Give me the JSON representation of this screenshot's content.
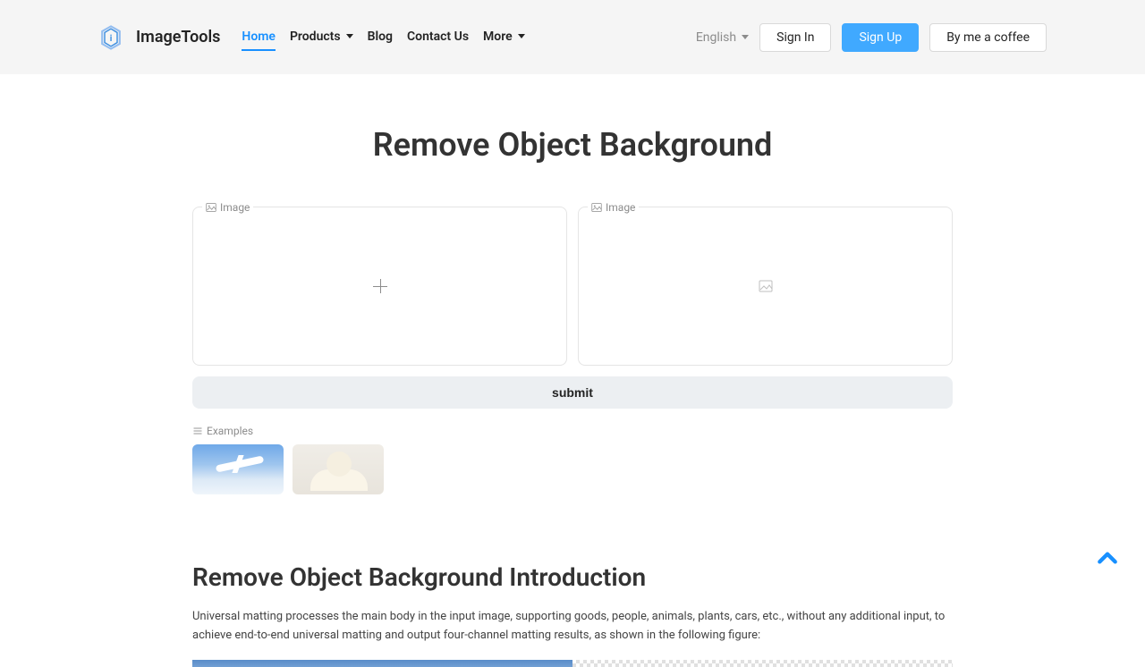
{
  "header": {
    "brand": "ImageTools",
    "nav": {
      "home": "Home",
      "products": "Products",
      "blog": "Blog",
      "contact": "Contact Us",
      "more": "More"
    },
    "language": "English",
    "sign_in": "Sign In",
    "sign_up": "Sign Up",
    "coffee": "By me a coffee"
  },
  "page": {
    "title": "Remove Object Background",
    "input_label": "Image",
    "output_label": "Image",
    "submit": "submit",
    "examples_label": "Examples"
  },
  "section": {
    "title": "Remove Object Background Introduction",
    "text": "Universal matting processes the main body in the input image, supporting goods, people, animals, plants, cars, etc., without any additional input, to achieve end-to-end universal matting and output four-channel matting results, as shown in the following figure:"
  }
}
